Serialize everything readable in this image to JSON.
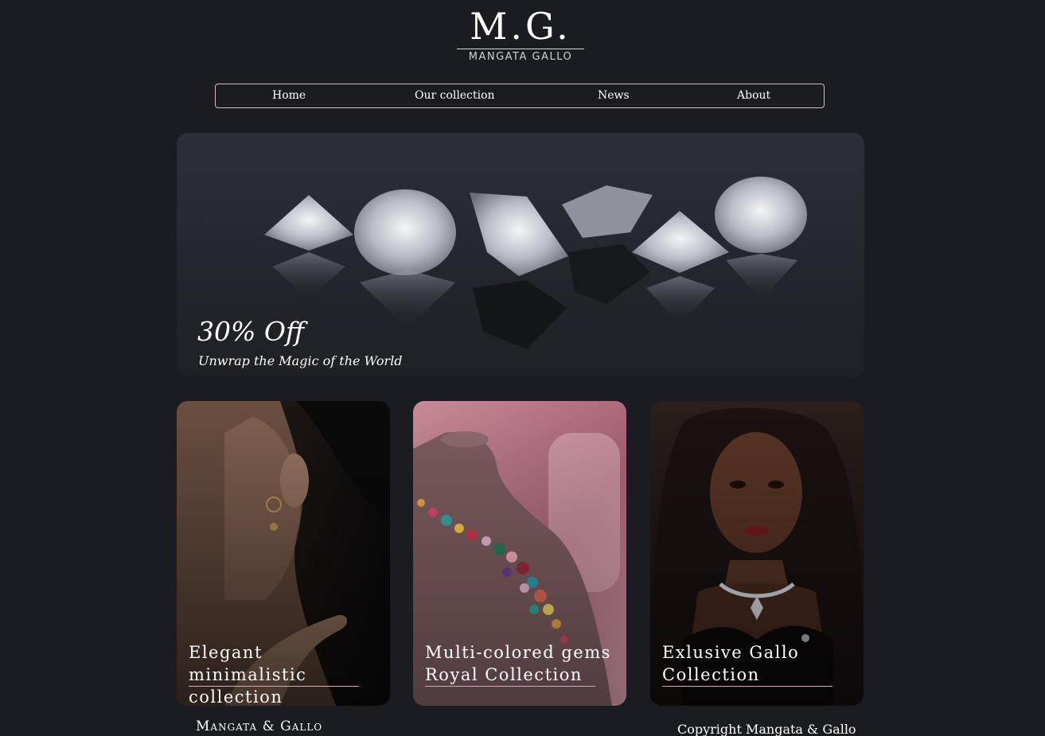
{
  "logo": {
    "mark": "M.G.",
    "name": "MANGATA GALLO"
  },
  "nav": {
    "items": [
      {
        "label": "Home"
      },
      {
        "label": "Our collection"
      },
      {
        "label": "News"
      },
      {
        "label": "About"
      }
    ]
  },
  "hero": {
    "title": "30% Off",
    "subtitle": "Unwrap the Magic of the World",
    "image": "diamonds-photo"
  },
  "cards": [
    {
      "title": "Elegant minimalistic collection",
      "image": "earring-model-photo"
    },
    {
      "title": "Multi-colored gems Royal Collection",
      "image": "necklace-bust-photo"
    },
    {
      "title": "Exlusive Gallo Collection",
      "image": "diamond-necklace-model-photo"
    }
  ],
  "footer": {
    "brand": "Mangata & Gallo",
    "copyright": "Copyright Mangata & Gallo"
  },
  "colors": {
    "background": "#1b1c22",
    "accent": "#d8b9c0"
  }
}
